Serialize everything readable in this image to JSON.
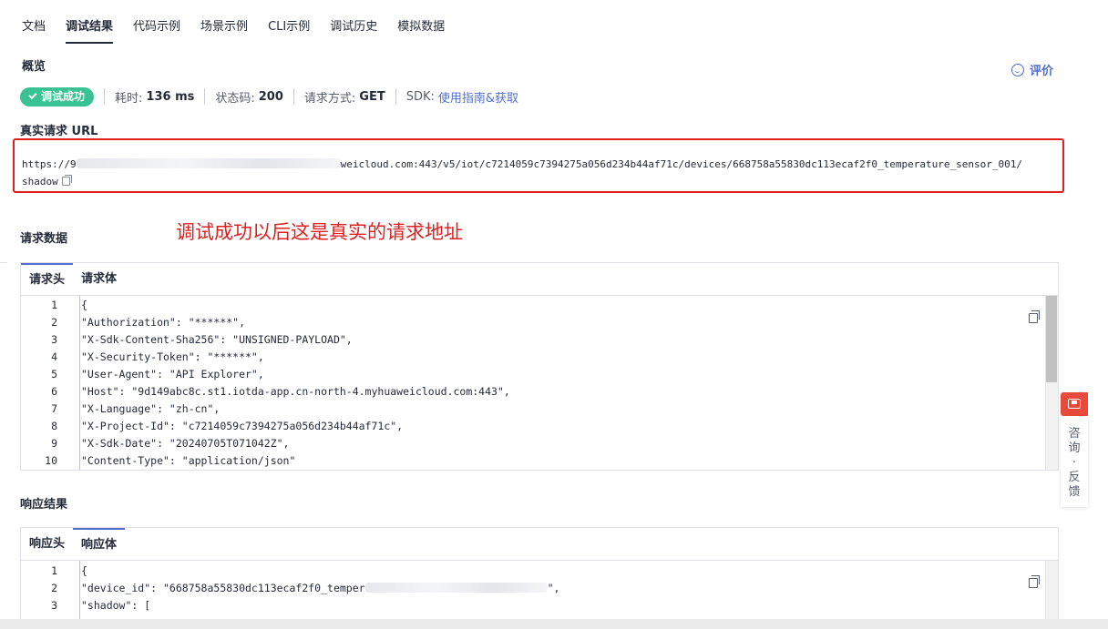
{
  "tabs": [
    "文档",
    "调试结果",
    "代码示例",
    "场景示例",
    "CLI示例",
    "调试历史",
    "模拟数据"
  ],
  "overview": {
    "title": "概览",
    "rate_label": "评价",
    "status_badge": "调试成功",
    "time_label": "耗时:",
    "time_value": "136 ms",
    "code_label": "状态码:",
    "code_value": "200",
    "method_label": "请求方式:",
    "method_value": "GET",
    "sdk_label": "SDK:",
    "sdk_link": "使用指南&获取"
  },
  "real_url": {
    "title": "真实请求 URL",
    "url_prefix": "https://9",
    "url_suffix": "weicloud.com:443/v5/iot/c7214059c7394275a056d234b44af71c/devices/668758a55830dc113ecaf2f0_temperature_sensor_001/",
    "url_last": "shadow"
  },
  "annotation": "调试成功以后这是真实的请求地址",
  "request": {
    "title": "请求数据",
    "tabs": [
      "请求头",
      "请求体"
    ],
    "lines": [
      {
        "n": "1",
        "text": "{"
      },
      {
        "n": "2",
        "text": "\"Authorization\": \"******\","
      },
      {
        "n": "3",
        "text": "\"X-Sdk-Content-Sha256\": \"UNSIGNED-PAYLOAD\","
      },
      {
        "n": "4",
        "text": "\"X-Security-Token\": \"******\","
      },
      {
        "n": "5",
        "text": "\"User-Agent\": \"API Explorer\","
      },
      {
        "n": "6",
        "text": "\"Host\": \"9d149abc8c.st1.iotda-app.cn-north-4.myhuaweicloud.com:443\","
      },
      {
        "n": "7",
        "text": "\"X-Language\": \"zh-cn\","
      },
      {
        "n": "8",
        "text": "\"X-Project-Id\": \"c7214059c7394275a056d234b44af71c\","
      },
      {
        "n": "9",
        "text": "\"X-Sdk-Date\": \"20240705T071042Z\","
      },
      {
        "n": "10",
        "text": "\"Content-Type\": \"application/json\""
      }
    ]
  },
  "response": {
    "title": "响应结果",
    "tabs": [
      "响应头",
      "响应体"
    ],
    "line1": {
      "n": "1",
      "text": "{"
    },
    "line2": {
      "n": "2",
      "text_a": "\"device_id\": \"668758a55830dc113ecaf2f0_temper",
      "text_b": "\","
    },
    "line3": {
      "n": "3",
      "text": "\"shadow\": ["
    }
  },
  "feedback": {
    "label": "咨询·反馈"
  }
}
